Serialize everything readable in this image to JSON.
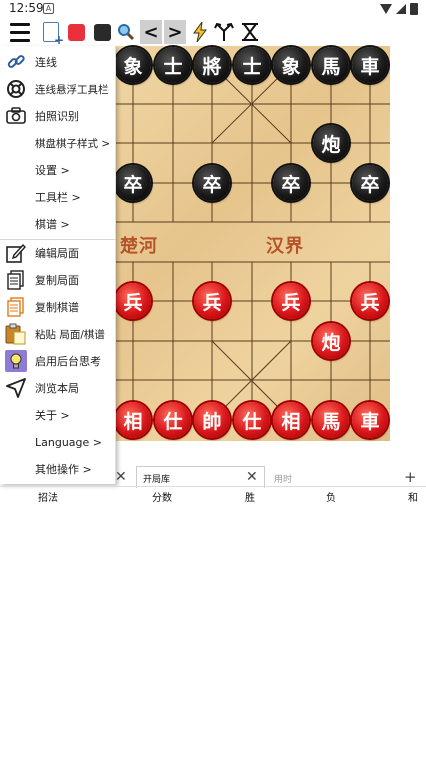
{
  "status_bar": {
    "time": "12:59",
    "notif_letter": "A"
  },
  "toolbar": {
    "icons": [
      "menu-icon",
      "new-document-icon",
      "red-side-icon",
      "black-side-icon",
      "search-icon",
      "previous-icon",
      "next-icon",
      "lightning-icon",
      "branch-icon",
      "hourglass-icon"
    ],
    "prev_glyph": "<",
    "next_glyph": ">"
  },
  "menu": {
    "items": [
      {
        "label": "连线"
      },
      {
        "label": "连线悬浮工具栏"
      },
      {
        "label": "拍照识别"
      },
      {
        "label": "棋盘棋子样式  >"
      },
      {
        "label": "设置  >"
      },
      {
        "label": "工具栏  >"
      },
      {
        "label": "棋谱  >"
      },
      {
        "label": "编辑局面"
      },
      {
        "label": "复制局面"
      },
      {
        "label": "复制棋谱"
      },
      {
        "label": "粘贴 局面/棋谱"
      },
      {
        "label": "启用后台思考"
      },
      {
        "label": "浏览本局"
      },
      {
        "label": "关于  >"
      },
      {
        "label": "Language  >"
      },
      {
        "label": "其他操作  >"
      }
    ]
  },
  "board": {
    "river_left": "楚河",
    "river_right": "汉界",
    "pieces": [
      {
        "text": "象",
        "side": "black",
        "file": 0,
        "rank": 0
      },
      {
        "text": "士",
        "side": "black",
        "file": 1,
        "rank": 0
      },
      {
        "text": "將",
        "side": "black",
        "file": 2,
        "rank": 0
      },
      {
        "text": "士",
        "side": "black",
        "file": 3,
        "rank": 0
      },
      {
        "text": "象",
        "side": "black",
        "file": 4,
        "rank": 0
      },
      {
        "text": "馬",
        "side": "black",
        "file": 5,
        "rank": 0
      },
      {
        "text": "車",
        "side": "black",
        "file": 6,
        "rank": 0
      },
      {
        "text": "炮",
        "side": "black",
        "file": 5,
        "rank": 2
      },
      {
        "text": "卒",
        "side": "black",
        "file": 0,
        "rank": 3
      },
      {
        "text": "卒",
        "side": "black",
        "file": 2,
        "rank": 3
      },
      {
        "text": "卒",
        "side": "black",
        "file": 4,
        "rank": 3
      },
      {
        "text": "卒",
        "side": "black",
        "file": 6,
        "rank": 3
      },
      {
        "text": "兵",
        "side": "red",
        "file": 0,
        "rank": 6
      },
      {
        "text": "兵",
        "side": "red",
        "file": 2,
        "rank": 6
      },
      {
        "text": "兵",
        "side": "red",
        "file": 4,
        "rank": 6
      },
      {
        "text": "兵",
        "side": "red",
        "file": 6,
        "rank": 6
      },
      {
        "text": "炮",
        "side": "red",
        "file": 5,
        "rank": 7
      },
      {
        "text": "相",
        "side": "red",
        "file": 0,
        "rank": 9
      },
      {
        "text": "仕",
        "side": "red",
        "file": 1,
        "rank": 9
      },
      {
        "text": "帥",
        "side": "red",
        "file": 2,
        "rank": 9
      },
      {
        "text": "仕",
        "side": "red",
        "file": 3,
        "rank": 9
      },
      {
        "text": "相",
        "side": "red",
        "file": 4,
        "rank": 9
      },
      {
        "text": "馬",
        "side": "red",
        "file": 5,
        "rank": 9
      },
      {
        "text": "車",
        "side": "red",
        "file": 6,
        "rank": 9
      }
    ]
  },
  "tabs": {
    "active_label": "开局库",
    "time_placeholder": "用时",
    "add_glyph": "+",
    "close_glyph": "✕"
  },
  "table_headers": [
    "招法",
    "分数",
    "胜",
    "负",
    "和"
  ]
}
